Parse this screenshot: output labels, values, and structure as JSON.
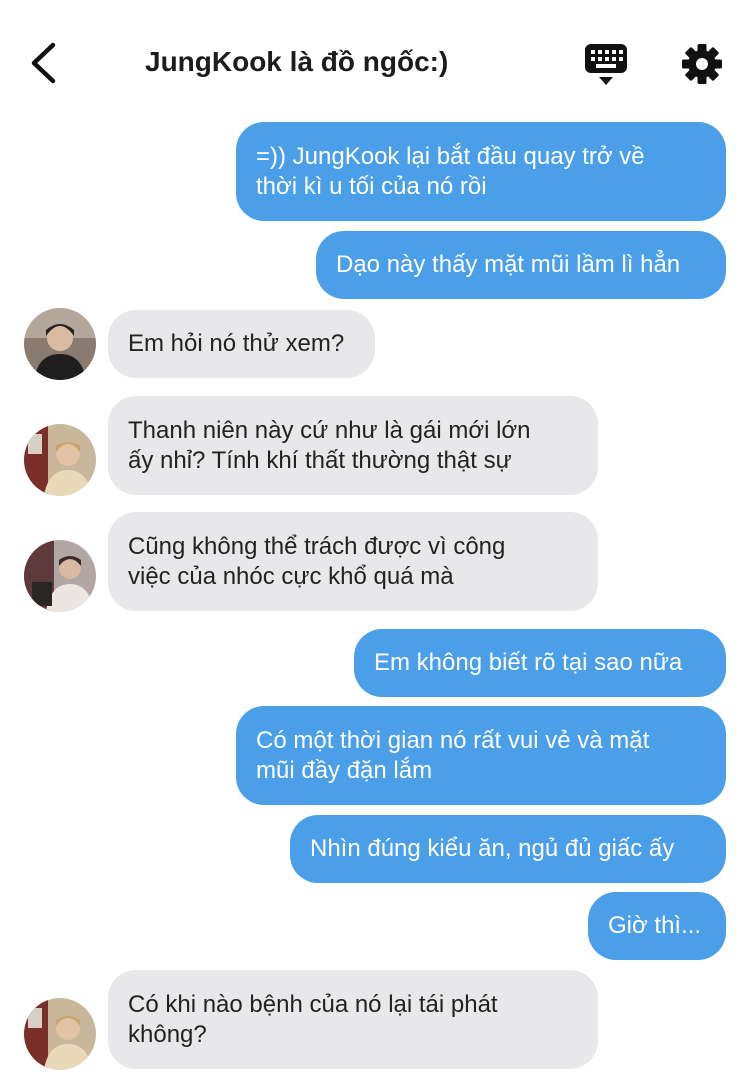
{
  "header": {
    "title": "JungKook là đồ ngốc:)",
    "back_icon": "chevron-left-icon",
    "keyboard_icon": "keyboard-icon",
    "settings_icon": "gear-icon"
  },
  "colors": {
    "outgoing_bubble": "#4b9ee8",
    "incoming_bubble": "#e8e8ea",
    "text_dark": "#1c1c1e"
  },
  "messages": [
    {
      "side": "out",
      "lines": [
        "=)) JungKook lại bắt đầu quay trở về",
        "thời kì u tối của nó rồi"
      ]
    },
    {
      "side": "out",
      "lines": [
        "Dạo này thấy mặt mũi lầm lì hẳn"
      ]
    },
    {
      "side": "in",
      "lines": [
        "Em hỏi nó thử xem?"
      ]
    },
    {
      "side": "in",
      "lines": [
        "Thanh niên này cứ như là gái mới lớn",
        "ấy nhỉ? Tính khí thất thường thật sự"
      ]
    },
    {
      "side": "in",
      "lines": [
        "Cũng không thể trách được vì công",
        "việc của nhóc cực khổ quá mà"
      ]
    },
    {
      "side": "out",
      "lines": [
        "Em không biết rõ tại sao nữa"
      ]
    },
    {
      "side": "out",
      "lines": [
        "Có một thời gian nó rất vui vẻ và mặt",
        "mũi đầy đặn lắm"
      ]
    },
    {
      "side": "out",
      "lines": [
        "Nhìn đúng kiểu ăn, ngủ đủ giấc ấy"
      ]
    },
    {
      "side": "out",
      "lines": [
        "Giờ thì..."
      ]
    },
    {
      "side": "in",
      "lines": [
        "Có khi nào bệnh của nó lại tái phát",
        "không?"
      ]
    }
  ]
}
